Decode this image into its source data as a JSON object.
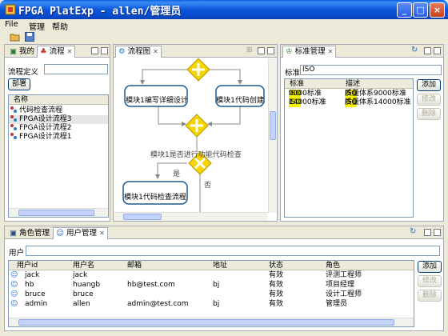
{
  "window": {
    "title": "FPGA PlatExp - allen/管理员"
  },
  "menu": [
    "File",
    "管理",
    "帮助"
  ],
  "left_panel": {
    "tabs": [
      "我的",
      "流程"
    ],
    "filter_label": "流程定义",
    "deploy_button": "部署",
    "column": "名称",
    "items": [
      "代码检查流程",
      "FPGA设计流程3",
      "FPGA设计流程2",
      "FPGA设计流程1"
    ]
  },
  "diagram_panel": {
    "tab": "流程图",
    "tasks": [
      "模块1编写详细设计",
      "模块1代码创建",
      "模块1代码检查流程"
    ],
    "condition_label": "模块1是否进行功能代码检查",
    "yes_label": "是",
    "no_label": "否"
  },
  "standards_panel": {
    "tab": "标准管理",
    "filter_label": "标准",
    "filter_value": "ISO",
    "columns": [
      "标准",
      "描述"
    ],
    "rows": [
      {
        "std_hl": "ISO",
        "std_rest": "9000标准",
        "desc_hl": "ISO",
        "desc_rest": "质量体系9000标准"
      },
      {
        "std_hl": "ISO",
        "std_rest": "14000标准",
        "desc_hl": "ISO",
        "desc_rest": "质量体系14000标准"
      }
    ],
    "buttons": [
      "添加",
      "修改",
      "删除"
    ]
  },
  "users_panel": {
    "tabs": [
      "角色管理",
      "用户管理"
    ],
    "filter_label": "用户",
    "columns": [
      "用户id",
      "用户名",
      "邮箱",
      "地址",
      "状态",
      "角色"
    ],
    "rows": [
      {
        "id": "jack",
        "name": "jack",
        "email": "",
        "address": "",
        "status": "有效",
        "role": "评测工程师"
      },
      {
        "id": "hb",
        "name": "huangb",
        "email": "hb@test.com",
        "address": "bj",
        "status": "有效",
        "role": "项目经理"
      },
      {
        "id": "bruce",
        "name": "bruce",
        "email": "",
        "address": "",
        "status": "有效",
        "role": "设计工程师"
      },
      {
        "id": "admin",
        "name": "allen",
        "email": "admin@test.com",
        "address": "bj",
        "status": "有效",
        "role": "管理员"
      }
    ],
    "buttons": [
      "添加",
      "修改",
      "删除"
    ]
  },
  "colors": {
    "title_bar": "#0a55d9",
    "highlight": "#f5f500",
    "gateway": "#f5d400",
    "task_border": "#1f5a8a"
  }
}
